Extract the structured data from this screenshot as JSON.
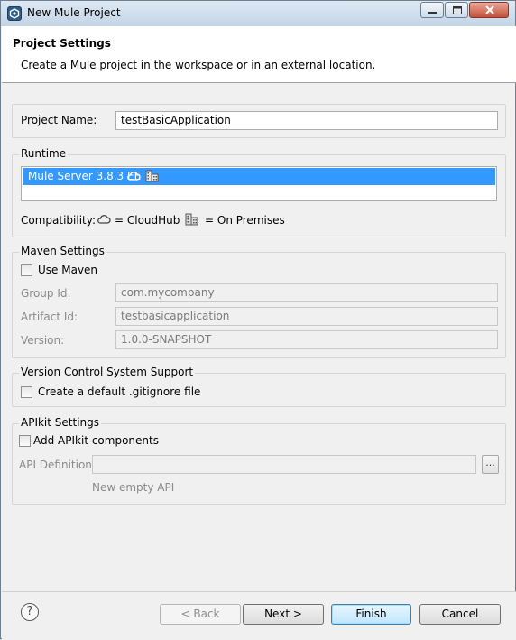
{
  "window": {
    "title": "New Mule Project"
  },
  "header": {
    "title": "Project Settings",
    "description": "Create a Mule project in the workspace or in an external location."
  },
  "project": {
    "name_label": "Project Name:",
    "name_value": "testBasicApplication"
  },
  "runtime": {
    "group_label": "Runtime",
    "selected": "Mule Server 3.8.3 EE",
    "compat_label": "Compatibility:",
    "cloudhub_label": "= CloudHub",
    "onprem_label": "= On Premises"
  },
  "maven": {
    "group_label": "Maven Settings",
    "use_maven_label": "Use Maven",
    "group_id_label": "Group Id:",
    "group_id_value": "com.mycompany",
    "artifact_id_label": "Artifact Id:",
    "artifact_id_value": "testbasicapplication",
    "version_label": "Version:",
    "version_value": "1.0.0-SNAPSHOT"
  },
  "vcs": {
    "group_label": "Version Control System Support",
    "gitignore_label": "Create a default .gitignore file"
  },
  "apikit": {
    "group_label": "APIkit Settings",
    "add_label": "Add APIkit components",
    "definition_label": "API Definition:",
    "definition_value": "",
    "browse_label": "...",
    "hint": "New empty API"
  },
  "buttons": {
    "back": "< Back",
    "next": "Next >",
    "finish": "Finish",
    "cancel": "Cancel",
    "help": "?"
  }
}
